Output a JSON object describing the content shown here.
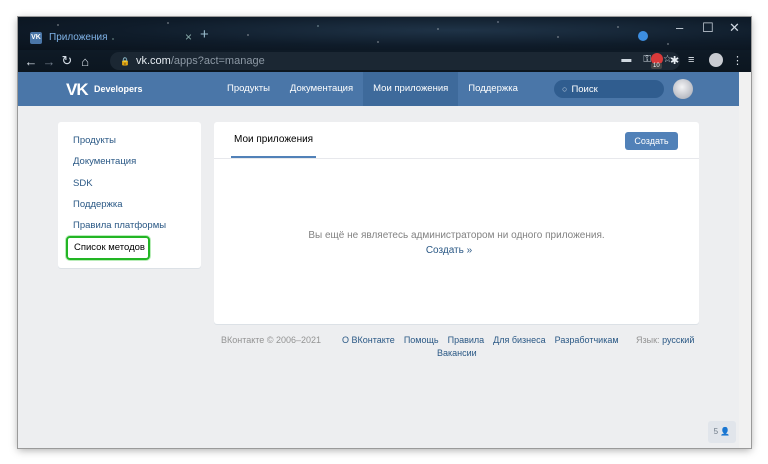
{
  "browser": {
    "tab_title": "Приложения",
    "tab_favicon": "VK",
    "tab_close": "×",
    "new_tab": "+",
    "url_host": "vk.com",
    "url_path": "/apps?act=manage",
    "window_controls": [
      "–",
      "☐",
      "✕"
    ],
    "ext_badge_count": "10"
  },
  "header": {
    "brand": "Developers",
    "nav": [
      "Продукты",
      "Документация",
      "Мои приложения",
      "Поддержка"
    ],
    "active_index": 2,
    "search_placeholder": "Поиск"
  },
  "sidebar": {
    "items": [
      {
        "label": "Продукты"
      },
      {
        "label": "Документация"
      },
      {
        "label": "SDK"
      },
      {
        "label": "Поддержка"
      },
      {
        "label": "Правила платформы"
      },
      {
        "label": "Список методов"
      }
    ]
  },
  "main": {
    "tab_label": "Мои приложения",
    "create_button": "Создать",
    "empty_message": "Вы ещё не являетесь администратором ни одного приложения.",
    "empty_link": "Создать »"
  },
  "footer": {
    "copyright": "ВКонтакте © 2006–2021",
    "links": [
      "О ВКонтакте",
      "Помощь",
      "Правила",
      "Для бизнеса",
      "Разработчикам"
    ],
    "vacancies": "Вакансии",
    "language_label": "Язык:",
    "language_value": "русский"
  },
  "corner_badge": "5"
}
